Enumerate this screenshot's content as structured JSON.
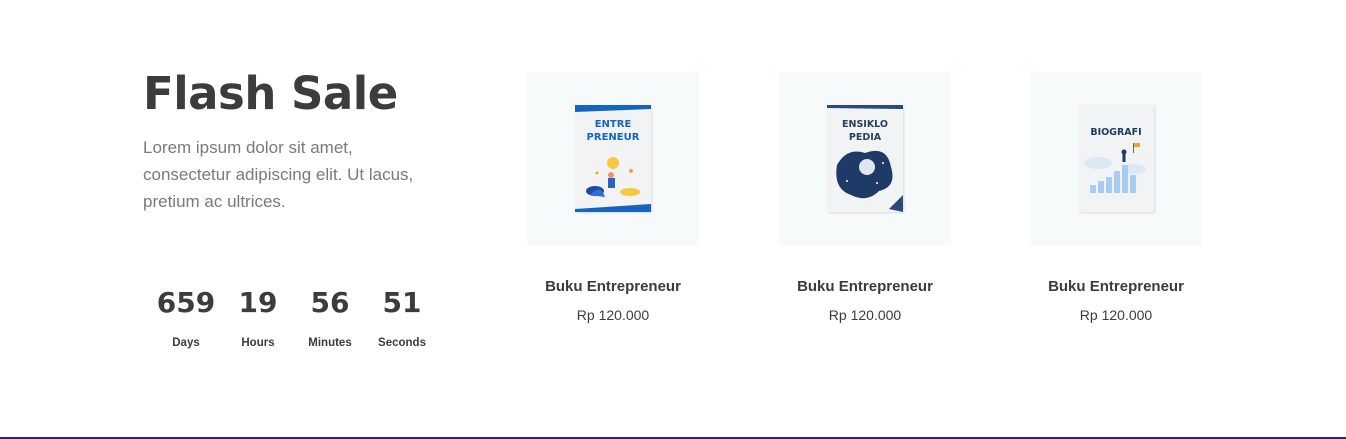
{
  "flash_sale": {
    "title": "Flash Sale",
    "description": "Lorem ipsum dolor sit amet, consectetur adipiscing elit. Ut lacus, pretium ac ultrices."
  },
  "countdown": [
    {
      "value": "659",
      "label": "Days"
    },
    {
      "value": "19",
      "label": "Hours"
    },
    {
      "value": "56",
      "label": "Minutes"
    },
    {
      "value": "51",
      "label": "Seconds"
    }
  ],
  "products": [
    {
      "name": "Buku Entrepreneur",
      "price": "Rp 120.000",
      "cover_line1": "ENTRE",
      "cover_line2": "PRENEUR",
      "cover_icon": "entrepreneur-illustration-icon",
      "accent": "#1565c0"
    },
    {
      "name": "Buku Entrepreneur",
      "price": "Rp 120.000",
      "cover_line1": "ENSIKLO",
      "cover_line2": "PEDIA",
      "cover_icon": "space-illustration-icon",
      "accent": "#2a4a7a"
    },
    {
      "name": "Buku Entrepreneur",
      "price": "Rp 120.000",
      "cover_line1": "BIOGRAFI",
      "cover_line2": "",
      "cover_icon": "growth-chart-icon",
      "accent": "#1f3a5f"
    }
  ]
}
